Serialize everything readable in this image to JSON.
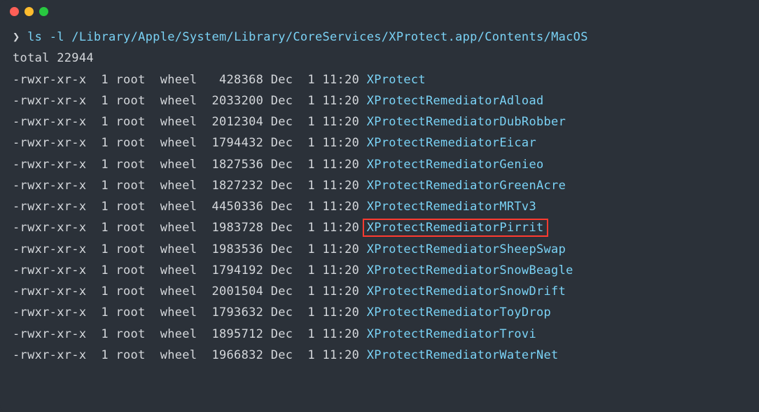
{
  "prompt": {
    "symbol": "❯",
    "command": "ls -l /Library/Apple/System/Library/CoreServices/XProtect.app/Contents/MacOS"
  },
  "total": "total 22944",
  "rows": [
    {
      "perms": "-rwxr-xr-x",
      "links": "1",
      "user": "root",
      "group": "wheel",
      "size": "428368",
      "month": "Dec",
      "day": "1",
      "time": "11:20",
      "name": "XProtect",
      "highlight": false
    },
    {
      "perms": "-rwxr-xr-x",
      "links": "1",
      "user": "root",
      "group": "wheel",
      "size": "2033200",
      "month": "Dec",
      "day": "1",
      "time": "11:20",
      "name": "XProtectRemediatorAdload",
      "highlight": false
    },
    {
      "perms": "-rwxr-xr-x",
      "links": "1",
      "user": "root",
      "group": "wheel",
      "size": "2012304",
      "month": "Dec",
      "day": "1",
      "time": "11:20",
      "name": "XProtectRemediatorDubRobber",
      "highlight": false
    },
    {
      "perms": "-rwxr-xr-x",
      "links": "1",
      "user": "root",
      "group": "wheel",
      "size": "1794432",
      "month": "Dec",
      "day": "1",
      "time": "11:20",
      "name": "XProtectRemediatorEicar",
      "highlight": false
    },
    {
      "perms": "-rwxr-xr-x",
      "links": "1",
      "user": "root",
      "group": "wheel",
      "size": "1827536",
      "month": "Dec",
      "day": "1",
      "time": "11:20",
      "name": "XProtectRemediatorGenieo",
      "highlight": false
    },
    {
      "perms": "-rwxr-xr-x",
      "links": "1",
      "user": "root",
      "group": "wheel",
      "size": "1827232",
      "month": "Dec",
      "day": "1",
      "time": "11:20",
      "name": "XProtectRemediatorGreenAcre",
      "highlight": false
    },
    {
      "perms": "-rwxr-xr-x",
      "links": "1",
      "user": "root",
      "group": "wheel",
      "size": "4450336",
      "month": "Dec",
      "day": "1",
      "time": "11:20",
      "name": "XProtectRemediatorMRTv3",
      "highlight": false
    },
    {
      "perms": "-rwxr-xr-x",
      "links": "1",
      "user": "root",
      "group": "wheel",
      "size": "1983728",
      "month": "Dec",
      "day": "1",
      "time": "11:20",
      "name": "XProtectRemediatorPirrit",
      "highlight": true
    },
    {
      "perms": "-rwxr-xr-x",
      "links": "1",
      "user": "root",
      "group": "wheel",
      "size": "1983536",
      "month": "Dec",
      "day": "1",
      "time": "11:20",
      "name": "XProtectRemediatorSheepSwap",
      "highlight": false
    },
    {
      "perms": "-rwxr-xr-x",
      "links": "1",
      "user": "root",
      "group": "wheel",
      "size": "1794192",
      "month": "Dec",
      "day": "1",
      "time": "11:20",
      "name": "XProtectRemediatorSnowBeagle",
      "highlight": false
    },
    {
      "perms": "-rwxr-xr-x",
      "links": "1",
      "user": "root",
      "group": "wheel",
      "size": "2001504",
      "month": "Dec",
      "day": "1",
      "time": "11:20",
      "name": "XProtectRemediatorSnowDrift",
      "highlight": false
    },
    {
      "perms": "-rwxr-xr-x",
      "links": "1",
      "user": "root",
      "group": "wheel",
      "size": "1793632",
      "month": "Dec",
      "day": "1",
      "time": "11:20",
      "name": "XProtectRemediatorToyDrop",
      "highlight": false
    },
    {
      "perms": "-rwxr-xr-x",
      "links": "1",
      "user": "root",
      "group": "wheel",
      "size": "1895712",
      "month": "Dec",
      "day": "1",
      "time": "11:20",
      "name": "XProtectRemediatorTrovi",
      "highlight": false
    },
    {
      "perms": "-rwxr-xr-x",
      "links": "1",
      "user": "root",
      "group": "wheel",
      "size": "1966832",
      "month": "Dec",
      "day": "1",
      "time": "11:20",
      "name": "XProtectRemediatorWaterNet",
      "highlight": false
    }
  ]
}
